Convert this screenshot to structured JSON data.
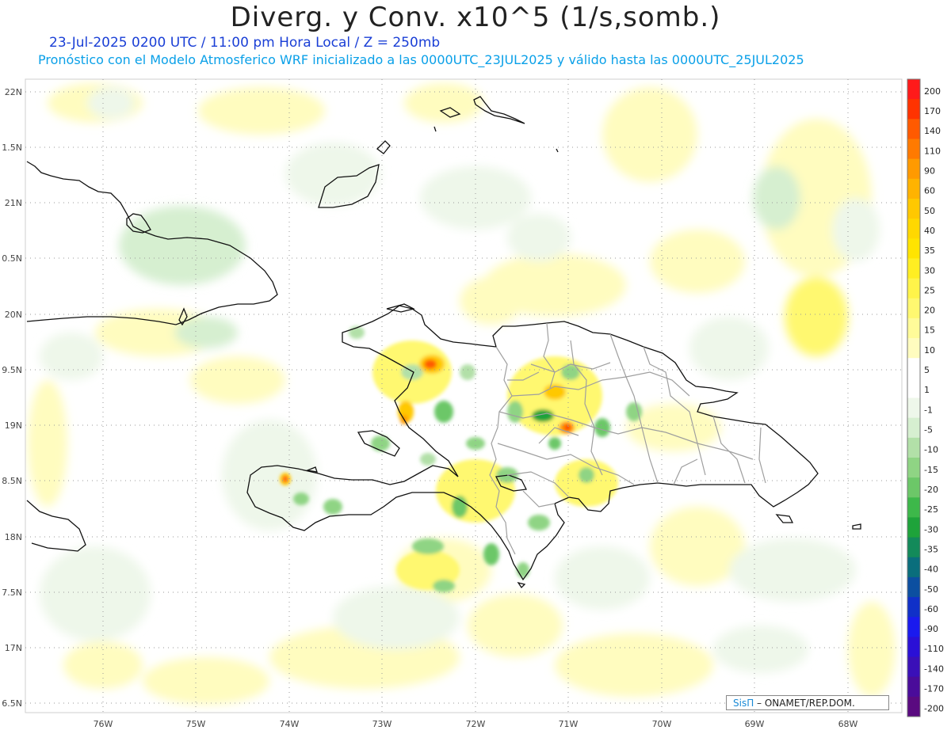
{
  "header": {
    "title": "Diverg. y Conv. x10^5 (1/s,somb.)",
    "subtitle_date": "23-Jul-2025  0200 UTC / 11:00 pm Hora Local / Z = 250mb",
    "subtitle_model": "Pronóstico con el Modelo Atmosferico WRF inicializado a las 0000UTC_23JUL2025 y válido hasta las  0000UTC_25JUL2025"
  },
  "axes": {
    "lat_labels": [
      "22N",
      "1.5N",
      "21N",
      "0.5N",
      "20N",
      "9.5N",
      "19N",
      "8.5N",
      "18N",
      "7.5N",
      "17N",
      "6.5N"
    ],
    "lon_labels": [
      "76W",
      "75W",
      "74W",
      "73W",
      "72W",
      "71W",
      "70W",
      "69W",
      "68W"
    ]
  },
  "colorbar": {
    "labels": [
      "200",
      "170",
      "140",
      "110",
      "90",
      "60",
      "50",
      "40",
      "35",
      "30",
      "25",
      "20",
      "15",
      "10",
      "5",
      "1",
      "-1",
      "-5",
      "-10",
      "-15",
      "-20",
      "-25",
      "-30",
      "-35",
      "-40",
      "-50",
      "-60",
      "-90",
      "-110",
      "-140",
      "-170",
      "-200"
    ],
    "colors": [
      "#ff1a1a",
      "#ff3300",
      "#ff5a00",
      "#ff7a00",
      "#ff9a00",
      "#ffb300",
      "#ffc800",
      "#ffd800",
      "#ffe400",
      "#ffee22",
      "#fff44a",
      "#fff870",
      "#fffb99",
      "#fffcbf",
      "#ffffff",
      "#ffffff",
      "#eef7ea",
      "#d6efd0",
      "#b2e0a8",
      "#8fd484",
      "#6cc768",
      "#3db84a",
      "#1ea33a",
      "#138a5a",
      "#0a6e7c",
      "#0c4fa0",
      "#1030c8",
      "#1a1aee",
      "#2a10d6",
      "#3a10b8",
      "#4a0c9a",
      "#5a0a80"
    ]
  },
  "credit": {
    "brand": "SisΠ",
    "text": " –  ONAMET/REP.DOM."
  }
}
